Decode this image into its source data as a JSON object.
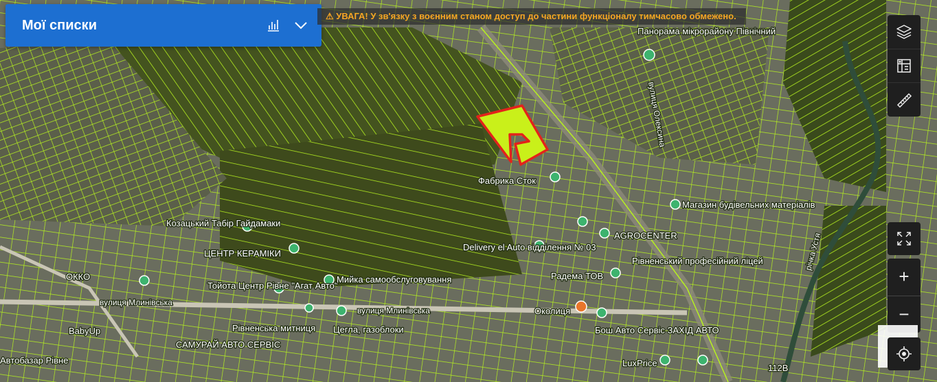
{
  "panel": {
    "title": "Мої списки"
  },
  "warning": {
    "text": "⚠ УВАГА! У зв'язку з воєнним станом доступ до частини функціоналу тимчасово обмежено."
  },
  "colors": {
    "panel": "#1d6fd1",
    "parcel_lines": "#b6f11f",
    "selected_fill": "#c9f01a",
    "selected_outline": "#e3231b",
    "warning_text": "#f6a623"
  },
  "toolbar": {
    "icons": [
      "layers-icon",
      "cadastre-icon",
      "ruler-icon"
    ]
  },
  "controls": {
    "fullscreen": "fullscreen-icon",
    "zoom_in": "+",
    "zoom_out": "−",
    "locate": "locate-icon"
  },
  "labels": {
    "panorama": "Панорама мікрорайону Північний",
    "street_oleksyna": "вулиця Олексина",
    "fabryka": "Фабрика Сток",
    "magazyn": "Магазин будівельних матеріалів",
    "kozatskyi": "Козацький Табір Гайдамаки",
    "tsentr": "ЦЕНТР КЕРАМІКИ",
    "delivery": "Delivery el Auto відділення № 03",
    "agrocenter": "AGROCENTER",
    "okko": "ОККО",
    "toyota": "Тойота Центр Рівне \"Агат Авто\"",
    "myika": "Мийка самообслуговування",
    "radema": "Радема ТОВ",
    "rivnenskyi": "Рівненський професійний ліцей",
    "street_mlyniv": "вулиця Млинівська",
    "okolytsia": "Околиця",
    "babyup": "BabyUp",
    "mytnytsia": "Рівненська митниця",
    "tsehla": "Цегла, газоблоки",
    "bosh": "Бош Авто Сервіс ЗАХІД АВТО",
    "samurai": "САМУРАЙ АВТО СЕРВІС",
    "avtobazar": "Автобазар Рівне",
    "luxprice": "LuxPrice",
    "river": "річка Устя",
    "house": "112В"
  }
}
